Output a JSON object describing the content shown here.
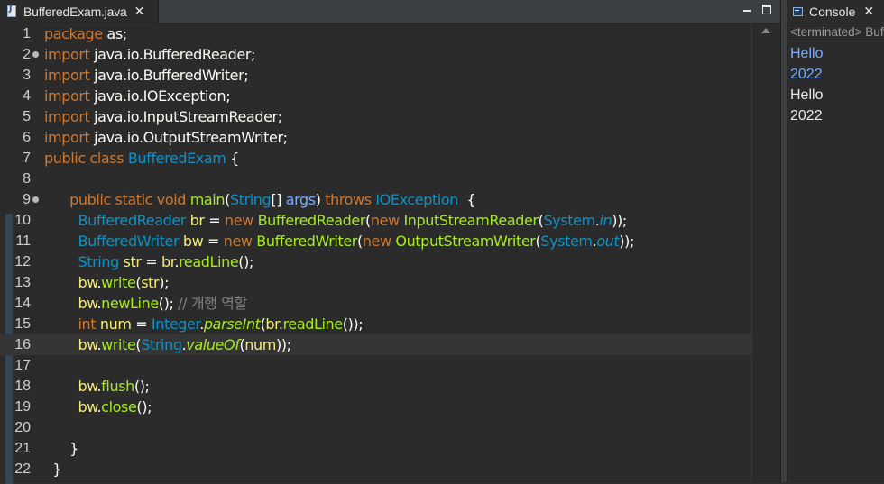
{
  "editor": {
    "tab_label": "BufferedExam.java",
    "tab_close": "✕",
    "lines": [
      {
        "n": "1",
        "fold": false,
        "tokens": [
          [
            "kw",
            "package"
          ],
          [
            "pl",
            " as;"
          ]
        ]
      },
      {
        "n": "2",
        "fold": true,
        "tokens": [
          [
            "kw",
            "import"
          ],
          [
            "pl",
            " java.io.BufferedReader;"
          ]
        ]
      },
      {
        "n": "3",
        "fold": false,
        "tokens": [
          [
            "kw",
            "import"
          ],
          [
            "pl",
            " java.io.BufferedWriter;"
          ]
        ]
      },
      {
        "n": "4",
        "fold": false,
        "tokens": [
          [
            "kw",
            "import"
          ],
          [
            "pl",
            " java.io.IOException;"
          ]
        ]
      },
      {
        "n": "5",
        "fold": false,
        "tokens": [
          [
            "kw",
            "import"
          ],
          [
            "pl",
            " java.io.InputStreamReader;"
          ]
        ]
      },
      {
        "n": "6",
        "fold": false,
        "tokens": [
          [
            "kw",
            "import"
          ],
          [
            "pl",
            " java.io.OutputStreamWriter;"
          ]
        ]
      },
      {
        "n": "7",
        "fold": false,
        "tokens": [
          [
            "kw",
            "public class"
          ],
          [
            "pl",
            " "
          ],
          [
            "ty",
            "BufferedExam"
          ],
          [
            "pl",
            " {"
          ]
        ]
      },
      {
        "n": "8",
        "fold": false,
        "tokens": []
      },
      {
        "n": "9",
        "fold": true,
        "tokens": [
          [
            "pl",
            "      "
          ],
          [
            "kw",
            "public static void"
          ],
          [
            "pl",
            " "
          ],
          [
            "mt",
            "main"
          ],
          [
            "pl",
            "("
          ],
          [
            "ty",
            "String"
          ],
          [
            "pl",
            "[] "
          ],
          [
            "vb",
            "args"
          ],
          [
            "pl",
            ") "
          ],
          [
            "kw",
            "throws"
          ],
          [
            "pl",
            " "
          ],
          [
            "ty",
            "IOException"
          ],
          [
            "pl",
            "  {"
          ]
        ]
      },
      {
        "n": "10",
        "fold": false,
        "tokens": [
          [
            "pl",
            "        "
          ],
          [
            "ty",
            "BufferedReader"
          ],
          [
            "pl",
            " "
          ],
          [
            "va",
            "br"
          ],
          [
            "pl",
            " = "
          ],
          [
            "kw",
            "new"
          ],
          [
            "pl",
            " "
          ],
          [
            "mt",
            "BufferedReader"
          ],
          [
            "pl",
            "("
          ],
          [
            "kw",
            "new"
          ],
          [
            "pl",
            " "
          ],
          [
            "mt",
            "InputStreamReader"
          ],
          [
            "pl",
            "("
          ],
          [
            "ty",
            "System"
          ],
          [
            "pl",
            "."
          ],
          [
            "st",
            "in"
          ],
          [
            "pl",
            "));"
          ]
        ]
      },
      {
        "n": "11",
        "fold": false,
        "tokens": [
          [
            "pl",
            "        "
          ],
          [
            "ty",
            "BufferedWriter"
          ],
          [
            "pl",
            " "
          ],
          [
            "va",
            "bw"
          ],
          [
            "pl",
            " = "
          ],
          [
            "kw",
            "new"
          ],
          [
            "pl",
            " "
          ],
          [
            "mt",
            "BufferedWriter"
          ],
          [
            "pl",
            "("
          ],
          [
            "kw",
            "new"
          ],
          [
            "pl",
            " "
          ],
          [
            "mt",
            "OutputStreamWriter"
          ],
          [
            "pl",
            "("
          ],
          [
            "ty",
            "System"
          ],
          [
            "pl",
            "."
          ],
          [
            "st",
            "out"
          ],
          [
            "pl",
            "));"
          ]
        ]
      },
      {
        "n": "12",
        "fold": false,
        "tokens": [
          [
            "pl",
            "        "
          ],
          [
            "ty",
            "String"
          ],
          [
            "pl",
            " "
          ],
          [
            "va",
            "str"
          ],
          [
            "pl",
            " = "
          ],
          [
            "va",
            "br"
          ],
          [
            "pl",
            "."
          ],
          [
            "mt",
            "readLine"
          ],
          [
            "pl",
            "();"
          ]
        ]
      },
      {
        "n": "13",
        "fold": false,
        "tokens": [
          [
            "pl",
            "        "
          ],
          [
            "va",
            "bw"
          ],
          [
            "pl",
            "."
          ],
          [
            "mt",
            "write"
          ],
          [
            "pl",
            "("
          ],
          [
            "va",
            "str"
          ],
          [
            "pl",
            ");"
          ]
        ]
      },
      {
        "n": "14",
        "fold": false,
        "tokens": [
          [
            "pl",
            "        "
          ],
          [
            "va",
            "bw"
          ],
          [
            "pl",
            "."
          ],
          [
            "mt",
            "newLine"
          ],
          [
            "pl",
            "(); "
          ],
          [
            "cm",
            "// 개행 역할"
          ]
        ]
      },
      {
        "n": "15",
        "fold": false,
        "tokens": [
          [
            "pl",
            "        "
          ],
          [
            "kw",
            "int"
          ],
          [
            "pl",
            " "
          ],
          [
            "va",
            "num"
          ],
          [
            "pl",
            " = "
          ],
          [
            "ty",
            "Integer"
          ],
          [
            "pl",
            "."
          ],
          [
            "mi",
            "parseInt"
          ],
          [
            "pl",
            "("
          ],
          [
            "va",
            "br"
          ],
          [
            "pl",
            "."
          ],
          [
            "mt",
            "readLine"
          ],
          [
            "pl",
            "());"
          ]
        ]
      },
      {
        "n": "16",
        "fold": false,
        "current": true,
        "tokens": [
          [
            "pl",
            "        "
          ],
          [
            "va",
            "bw"
          ],
          [
            "pl",
            "."
          ],
          [
            "mt",
            "write"
          ],
          [
            "pl",
            "("
          ],
          [
            "ty",
            "String"
          ],
          [
            "pl",
            "."
          ],
          [
            "mi",
            "valueOf"
          ],
          [
            "pl",
            "("
          ],
          [
            "va",
            "num"
          ],
          [
            "pl",
            "));"
          ]
        ]
      },
      {
        "n": "17",
        "fold": false,
        "tokens": []
      },
      {
        "n": "18",
        "fold": false,
        "tokens": [
          [
            "pl",
            "        "
          ],
          [
            "va",
            "bw"
          ],
          [
            "pl",
            "."
          ],
          [
            "mt",
            "flush"
          ],
          [
            "pl",
            "();"
          ]
        ]
      },
      {
        "n": "19",
        "fold": false,
        "tokens": [
          [
            "pl",
            "        "
          ],
          [
            "va",
            "bw"
          ],
          [
            "pl",
            "."
          ],
          [
            "mt",
            "close"
          ],
          [
            "pl",
            "();"
          ]
        ]
      },
      {
        "n": "20",
        "fold": false,
        "tokens": []
      },
      {
        "n": "21",
        "fold": false,
        "tokens": [
          [
            "pl",
            "      }"
          ]
        ]
      },
      {
        "n": "22",
        "fold": false,
        "tokens": [
          [
            "pl",
            "  }"
          ]
        ]
      }
    ]
  },
  "console": {
    "title": "Console",
    "close": "✕",
    "status": "<terminated> BufferedExam [Java Application]",
    "lines": [
      {
        "text": "Hello",
        "kind": "input"
      },
      {
        "text": "2022",
        "kind": "input"
      },
      {
        "text": "Hello",
        "kind": "output"
      },
      {
        "text": "2022",
        "kind": "output"
      }
    ]
  },
  "colors": {
    "keyword": "#cc7832",
    "type": "#1290c3",
    "method": "#a7ec21",
    "field": "#f3ec79",
    "param": "#79abff",
    "comment": "#808080",
    "console_input": "#79abff"
  }
}
